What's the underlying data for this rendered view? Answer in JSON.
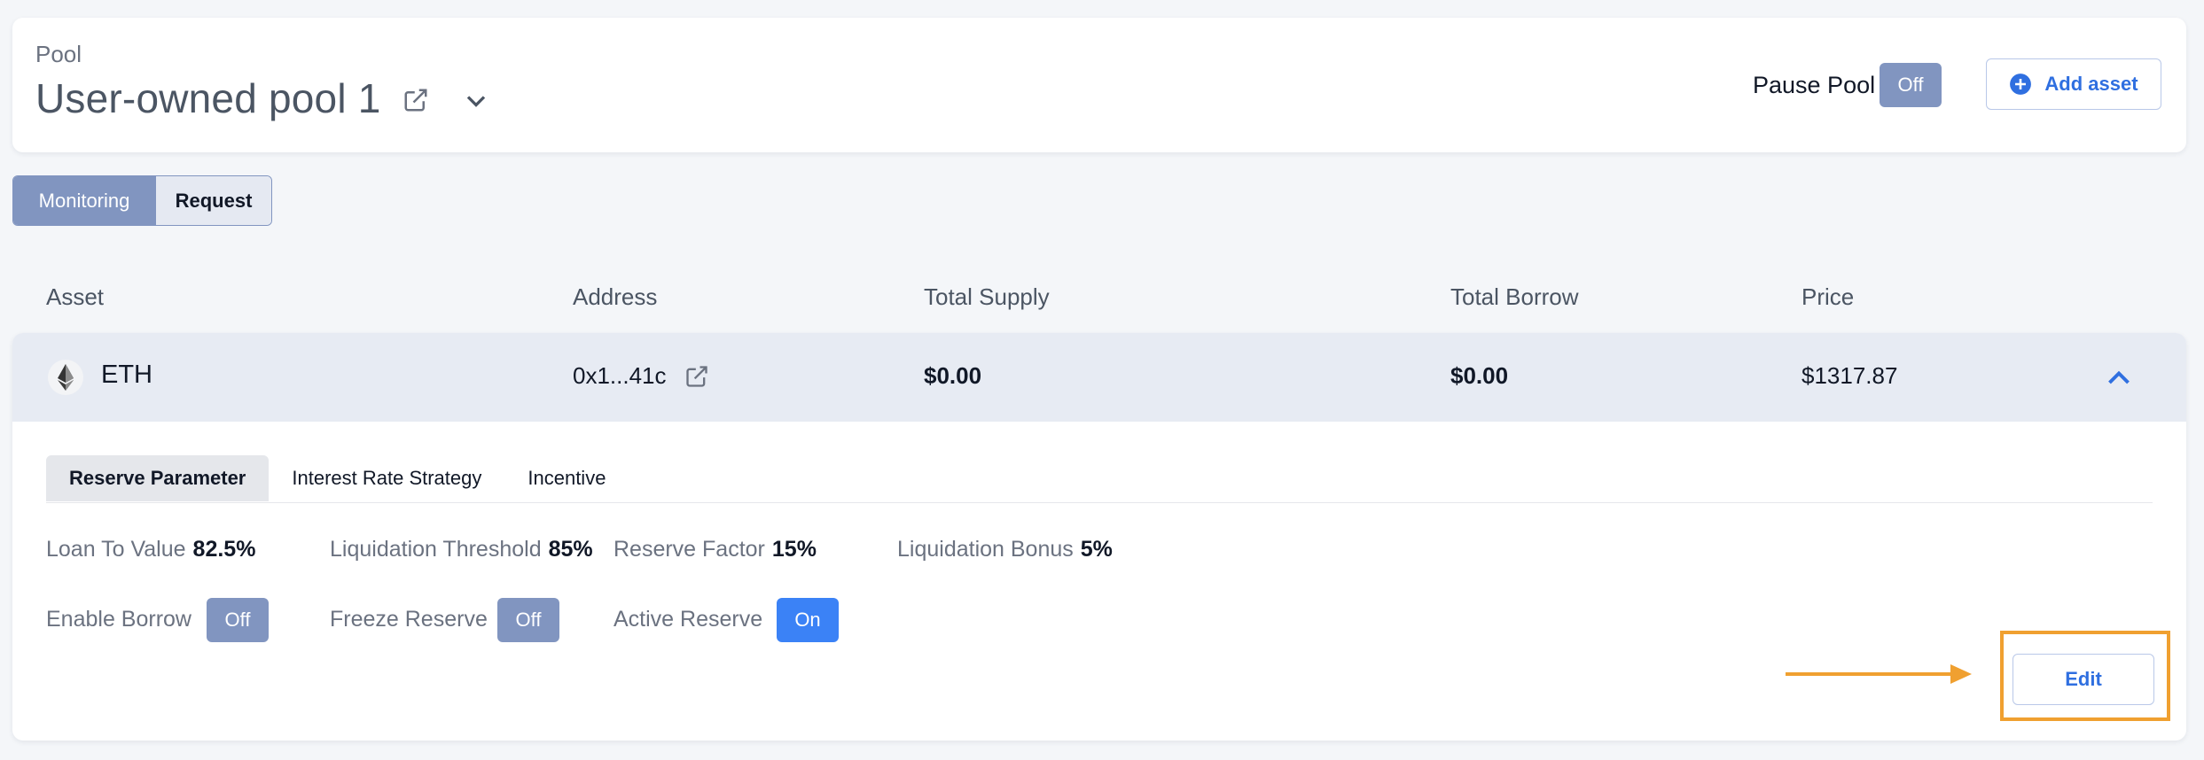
{
  "header": {
    "pool_label": "Pool",
    "pool_title": "User-owned pool 1",
    "pause_label": "Pause Pool",
    "pause_toggle": "Off",
    "add_asset_label": "Add asset"
  },
  "view_tabs": [
    {
      "label": "Monitoring",
      "active": true
    },
    {
      "label": "Request",
      "active": false
    }
  ],
  "table": {
    "columns": [
      "Asset",
      "Address",
      "Total Supply",
      "Total Borrow",
      "Price"
    ],
    "rows": [
      {
        "asset": "ETH",
        "address": "0x1...41c",
        "total_supply": "$0.00",
        "total_borrow": "$0.00",
        "price": "$1317.87",
        "expanded": true
      }
    ]
  },
  "detail_tabs": [
    {
      "label": "Reserve Parameter",
      "active": true
    },
    {
      "label": "Interest Rate Strategy",
      "active": false
    },
    {
      "label": "Incentive",
      "active": false
    }
  ],
  "parameters": [
    {
      "label": "Loan To Value",
      "value": "82.5%"
    },
    {
      "label": "Liquidation Threshold",
      "value": "85%"
    },
    {
      "label": "Reserve Factor",
      "value": "15%"
    },
    {
      "label": "Liquidation Bonus",
      "value": "5%"
    }
  ],
  "toggles": [
    {
      "label": "Enable Borrow",
      "state": "Off"
    },
    {
      "label": "Freeze Reserve",
      "state": "Off"
    },
    {
      "label": "Active Reserve",
      "state": "On"
    }
  ],
  "edit_label": "Edit",
  "colors": {
    "accent": "#2f6fe0",
    "toggle_off": "#8195c0",
    "toggle_on": "#3b82f6",
    "highlight": "#f0a030"
  },
  "icons": [
    "external-link-icon",
    "chevron-down-icon",
    "plus-circle-icon",
    "eth-icon",
    "chevron-up-icon",
    "arrow-right-icon"
  ]
}
